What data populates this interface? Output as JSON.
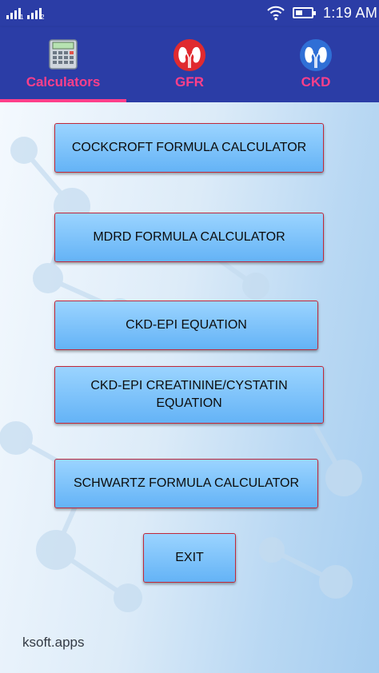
{
  "status_bar": {
    "sim1_label": "1",
    "sim2_label": "2",
    "time": "1:19 AM"
  },
  "tabs": [
    {
      "label": "Calculators",
      "icon": "calculator-icon",
      "active": true
    },
    {
      "label": "GFR",
      "icon": "kidney-red-icon",
      "active": false
    },
    {
      "label": "CKD",
      "icon": "kidney-blue-icon",
      "active": false
    }
  ],
  "buttons": {
    "cockcroft": "COCKCROFT FORMULA CALCULATOR",
    "mdrd": "MDRD FORMULA CALCULATOR",
    "ckd_epi": "CKD-EPI EQUATION",
    "ckd_epi_cystatin": "CKD-EPI CREATININE/CYSTATIN EQUATION",
    "schwartz": "SCHWARTZ FORMULA CALCULATOR",
    "exit": "EXIT"
  },
  "footer": {
    "brand": "ksoft.apps"
  },
  "colors": {
    "bar_background": "#2b3da6",
    "accent_pink": "#ff3f8a",
    "button_border": "#c0283a",
    "button_fill": "#64b3f6"
  }
}
